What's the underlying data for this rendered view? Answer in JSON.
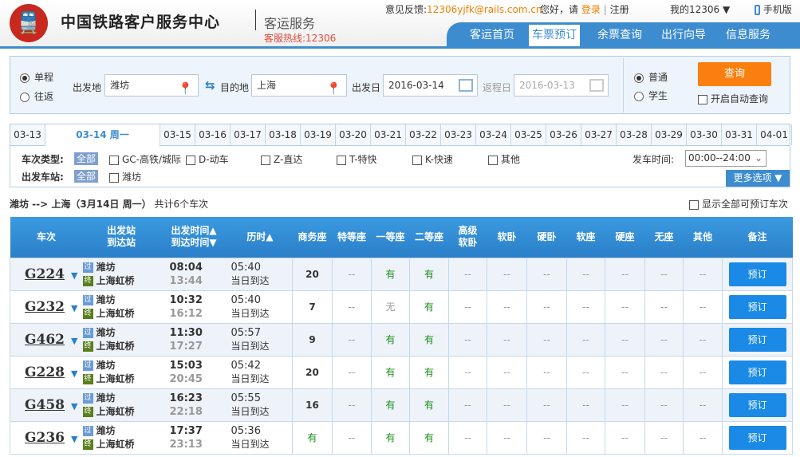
{
  "header": {
    "logo_glyph": "Ⓡ",
    "brand": "中国铁路客户服务中心",
    "subtitle": "客运服务",
    "hotline": "客服热线:12306",
    "feedback_label": "意见反馈:",
    "feedback_email": "12306yjfk@rails.com.cn",
    "greeting": "您好，请",
    "login": "登录",
    "register": "注册",
    "my12306": "我的12306 ▼",
    "mobile": "手机版",
    "nav": [
      "客运首页",
      "车票预订",
      "余票查询",
      "出行向导",
      "信息服务"
    ],
    "nav_active": "车票预订"
  },
  "search": {
    "one_way": "单程",
    "round_trip": "往返",
    "from_label": "出发地",
    "from_value": "潍坊",
    "to_label": "目的地",
    "to_value": "上海",
    "depart_label": "出发日",
    "depart_value": "2016-03-14",
    "return_label": "返程日",
    "return_value": "2016-03-13",
    "normal": "普通",
    "student": "学生",
    "query_button": "查询",
    "auto_query": "开启自动查询"
  },
  "dates": [
    "03-13",
    "03-14 周一",
    "03-15",
    "03-16",
    "03-17",
    "03-18",
    "03-19",
    "03-20",
    "03-21",
    "03-22",
    "03-23",
    "03-24",
    "03-25",
    "03-26",
    "03-27",
    "03-28",
    "03-29",
    "03-30",
    "03-31",
    "04-01"
  ],
  "filters": {
    "type_label": "车次类型:",
    "all": "全部",
    "types": [
      "GC-高铁/城际",
      "D-动车",
      "Z-直达",
      "T-特快",
      "K-快速",
      "其他"
    ],
    "station_label": "出发车站:",
    "stations": [
      "潍坊"
    ],
    "time_label": "发车时间:",
    "time_value": "00:00--24:00",
    "more": "更多选项 ▼"
  },
  "summary": {
    "route": "潍坊 --> 上海（3月14日  周一）",
    "count": "共计6个车次",
    "show_all": "显示全部可预订车次"
  },
  "table": {
    "headers": [
      "车次",
      "出发站\n到达站",
      "出发时间▲\n到达时间▼",
      "历时▲",
      "商务座",
      "特等座",
      "一等座",
      "二等座",
      "高级\n软卧",
      "软卧",
      "硬卧",
      "软座",
      "硬座",
      "无座",
      "其他",
      "备注"
    ],
    "rows": [
      {
        "train": "G224",
        "from": "潍坊",
        "to": "上海虹桥",
        "dep": "08:04",
        "arr": "13:44",
        "dur": "05:40",
        "day": "当日到达",
        "seats": [
          "20",
          "--",
          "有",
          "有",
          "--",
          "--",
          "--",
          "--",
          "--",
          "--",
          "--"
        ],
        "action": "预订"
      },
      {
        "train": "G232",
        "from": "潍坊",
        "to": "上海虹桥",
        "dep": "10:32",
        "arr": "16:12",
        "dur": "05:40",
        "day": "当日到达",
        "seats": [
          "7",
          "--",
          "无",
          "有",
          "--",
          "--",
          "--",
          "--",
          "--",
          "--",
          "--"
        ],
        "action": "预订"
      },
      {
        "train": "G462",
        "from": "潍坊",
        "to": "上海虹桥",
        "dep": "11:30",
        "arr": "17:27",
        "dur": "05:57",
        "day": "当日到达",
        "seats": [
          "9",
          "--",
          "有",
          "有",
          "--",
          "--",
          "--",
          "--",
          "--",
          "--",
          "--"
        ],
        "action": "预订"
      },
      {
        "train": "G228",
        "from": "潍坊",
        "to": "上海虹桥",
        "dep": "15:03",
        "arr": "20:45",
        "dur": "05:42",
        "day": "当日到达",
        "seats": [
          "20",
          "--",
          "有",
          "有",
          "--",
          "--",
          "--",
          "--",
          "--",
          "--",
          "--"
        ],
        "action": "预订"
      },
      {
        "train": "G458",
        "from": "潍坊",
        "to": "上海虹桥",
        "dep": "16:23",
        "arr": "22:18",
        "dur": "05:55",
        "day": "当日到达",
        "seats": [
          "16",
          "--",
          "有",
          "有",
          "--",
          "--",
          "--",
          "--",
          "--",
          "--",
          "--"
        ],
        "action": "预订"
      },
      {
        "train": "G236",
        "from": "潍坊",
        "to": "上海虹桥",
        "dep": "17:37",
        "arr": "23:13",
        "dur": "05:36",
        "day": "当日到达",
        "seats": [
          "有",
          "--",
          "有",
          "有",
          "--",
          "--",
          "--",
          "--",
          "--",
          "--",
          "--"
        ],
        "action": "预订"
      }
    ],
    "pass_icon": "过",
    "end_icon": "终"
  }
}
